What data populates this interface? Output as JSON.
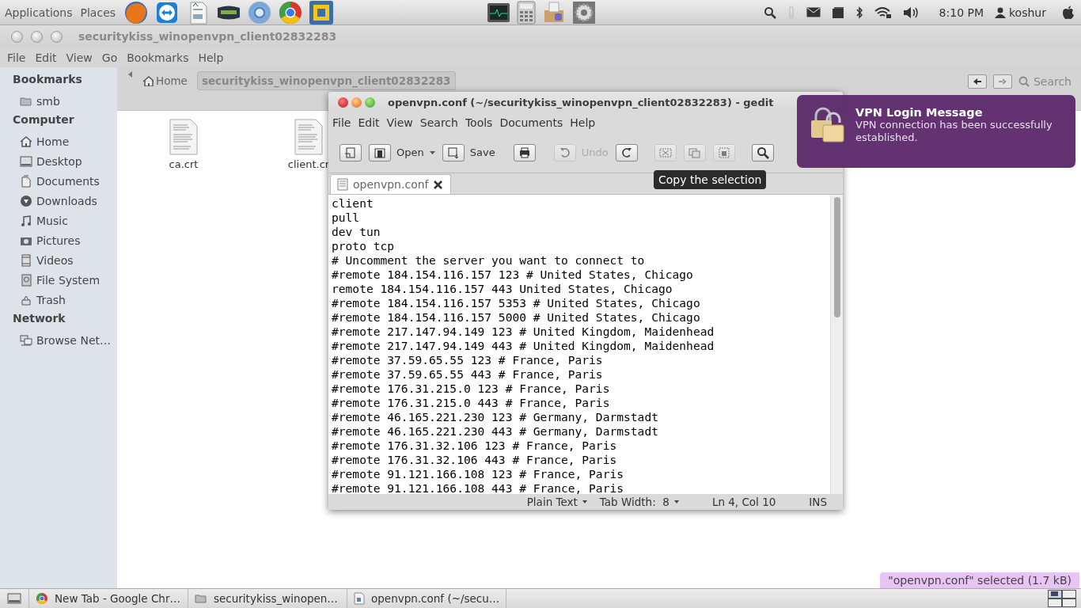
{
  "top_panel": {
    "menus": [
      "Applications",
      "Places"
    ],
    "launchers": [
      {
        "kind": "firefox"
      },
      {
        "kind": "teamviewer"
      },
      {
        "kind": "writer"
      },
      {
        "kind": "xbmc"
      },
      {
        "kind": "chromium"
      },
      {
        "kind": "chrome"
      },
      {
        "kind": "vmware"
      }
    ],
    "center_launchers": [
      {
        "kind": "monitor"
      },
      {
        "kind": "calculator"
      },
      {
        "kind": "package"
      },
      {
        "kind": "gear"
      }
    ],
    "tray": [
      {
        "kind": "search"
      },
      {
        "kind": "thermo"
      },
      {
        "kind": "mail"
      },
      {
        "kind": "window"
      },
      {
        "kind": "bluetooth"
      },
      {
        "kind": "wifi"
      },
      {
        "kind": "volume"
      }
    ],
    "clock": "8:10 PM",
    "user": "koshur"
  },
  "file_manager": {
    "title": "securitykiss_winopenvpn_client02832283",
    "menu": [
      "File",
      "Edit",
      "View",
      "Go",
      "Bookmarks",
      "Help"
    ],
    "sidebar": [
      {
        "heading": "Bookmarks",
        "items": [
          {
            "label": "smb",
            "kind": "folder"
          }
        ]
      },
      {
        "heading": "Computer",
        "items": [
          {
            "label": "Home",
            "kind": "home"
          },
          {
            "label": "Desktop",
            "kind": "desktop"
          },
          {
            "label": "Documents",
            "kind": "documents"
          },
          {
            "label": "Downloads",
            "kind": "downloads"
          },
          {
            "label": "Music",
            "kind": "music"
          },
          {
            "label": "Pictures",
            "kind": "pictures"
          },
          {
            "label": "Videos",
            "kind": "videos"
          },
          {
            "label": "File System",
            "kind": "disk"
          },
          {
            "label": "Trash",
            "kind": "trash"
          }
        ]
      },
      {
        "heading": "Network",
        "items": [
          {
            "label": "Browse Net…",
            "kind": "network"
          }
        ]
      }
    ],
    "path": [
      {
        "label": "Home",
        "selected": false
      },
      {
        "label": "securitykiss_winopenvpn_client02832283",
        "selected": true
      }
    ],
    "search": "Search",
    "files": [
      {
        "name": "ca.crt"
      },
      {
        "name": "client.cr"
      }
    ],
    "status": "\"openvpn.conf\" selected (1.7 kB)"
  },
  "editor": {
    "title": "openvpn.conf (~/securitykiss_winopenvpn_client02832283) - gedit",
    "menu": [
      "File",
      "Edit",
      "View",
      "Search",
      "Tools",
      "Documents",
      "Help"
    ],
    "toolbar": [
      {
        "kind": "new",
        "disabled": false
      },
      {
        "kind": "open",
        "label": "Open",
        "disabled": false
      },
      {
        "kind": "save",
        "label": "Save",
        "disabled": false
      },
      {
        "kind": "print",
        "disabled": false
      },
      {
        "kind": "undo",
        "label": "Undo",
        "disabled": true
      },
      {
        "kind": "redo",
        "disabled": false
      },
      {
        "kind": "cut",
        "disabled": true
      },
      {
        "kind": "copy",
        "disabled": true
      },
      {
        "kind": "paste",
        "disabled": true
      },
      {
        "kind": "find",
        "disabled": false
      }
    ],
    "tabs": [
      {
        "label": "openvpn.conf",
        "selected": true
      }
    ],
    "lines": [
      "client",
      "pull",
      "dev tun",
      "proto tcp",
      "# Uncomment the server you want to connect to",
      "#remote 184.154.116.157 123 # United States, Chicago",
      "remote 184.154.116.157 443 United States, Chicago",
      "#remote 184.154.116.157 5353 # United States, Chicago",
      "#remote 184.154.116.157 5000 # United States, Chicago",
      "#remote 217.147.94.149 123 # United Kingdom, Maidenhead",
      "#remote 217.147.94.149 443 # United Kingdom, Maidenhead",
      "#remote 37.59.65.55 123 # France, Paris",
      "#remote 37.59.65.55 443 # France, Paris",
      "#remote 176.31.215.0 123 # France, Paris",
      "#remote 176.31.215.0 443 # France, Paris",
      "#remote 46.165.221.230 123 # Germany, Darmstadt",
      "#remote 46.165.221.230 443 # Germany, Darmstadt",
      "#remote 176.31.32.106 123 # France, Paris",
      "#remote 176.31.32.106 443 # France, Paris",
      "#remote 91.121.166.108 123 # France, Paris",
      "#remote 91.121.166.108 443 # France, Paris"
    ],
    "status_bar": {
      "language": "Plain Text",
      "tab_width": "Tab Width:  8",
      "position": "Ln 4, Col 10",
      "mode": "INS"
    }
  },
  "tooltip": "Copy the selection",
  "notification": {
    "title": "VPN Login Message",
    "body": "VPN connection has been successfully established."
  },
  "taskbar": [
    {
      "kind": "chrome",
      "label": "New Tab - Google Chr…"
    },
    {
      "kind": "folder",
      "label": "securitykiss_winopen…"
    },
    {
      "kind": "textfile",
      "label": "openvpn.conf (~/secu…"
    }
  ]
}
